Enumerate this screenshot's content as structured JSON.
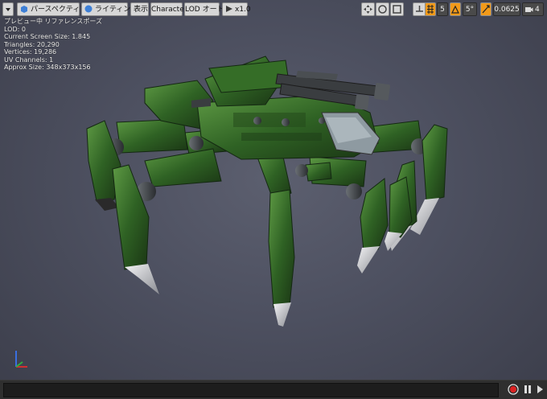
{
  "toolbar": {
    "perspective_label": "パースペクティブ",
    "lighting_label": "ライティング",
    "show_label": "表示",
    "character_label": "Character",
    "lod_label": "LOD オート",
    "speed_label": "x1.0",
    "angle_snap_value": "5",
    "rotation_snap_value": "5°",
    "scale_snap_value": "0.0625",
    "camera_speed_value": "4"
  },
  "stats": {
    "preview_line": "プレビュー中 リファレンスポーズ",
    "lod": "LOD: 0",
    "screen_size": "Current Screen Size: 1.845",
    "triangles": "Triangles: 20,290",
    "vertices": "Vertices: 19,286",
    "uv_channels": "UV Channels: 1",
    "approx_size": "Approx Size: 348x373x156"
  },
  "icons": {
    "menu": "menu-triangle-icon",
    "perspective": "perspective-cube-icon",
    "lighting": "lighting-sphere-icon",
    "play": "play-icon",
    "record": "record-icon",
    "pause": "pause-icon"
  },
  "colors": {
    "viewport_bg": "#4d5060",
    "armor_green": "#3f7a2e",
    "armor_dark": "#1f3d17",
    "claw": "#d9d9dc",
    "accent_orange": "#f29a1a"
  }
}
